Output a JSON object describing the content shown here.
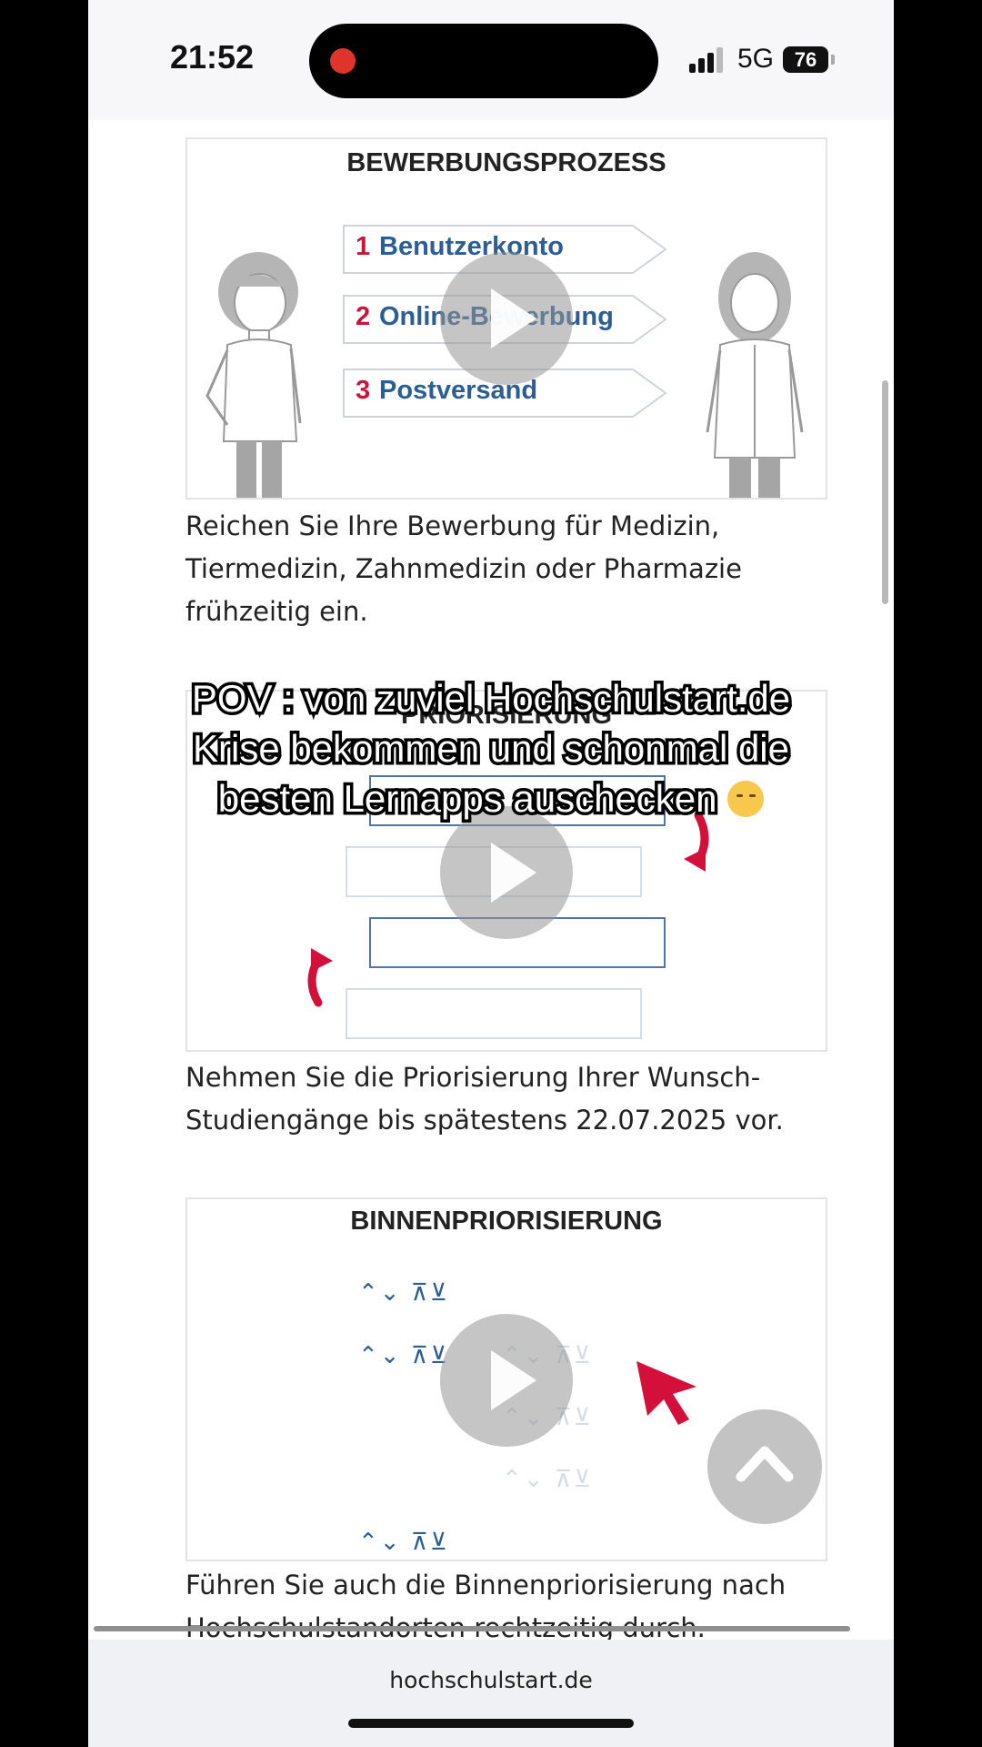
{
  "status": {
    "time": "21:52",
    "network": "5G",
    "battery": "76"
  },
  "figures": {
    "bewerbung": {
      "title": "BEWERBUNGSPROZESS",
      "steps": [
        {
          "num": "1",
          "label": "Benutzerkonto"
        },
        {
          "num": "2",
          "label": "Online-Bewerbung"
        },
        {
          "num": "3",
          "label": "Postversand"
        }
      ],
      "caption": "Reichen Sie Ihre Bewerbung für Medizin, Tiermedizin, Zahnmedizin oder Pharmazie frühzeitig ein."
    },
    "prio": {
      "title": "PRIORISIERUNG",
      "caption": "Nehmen Sie die Priorisierung Ihrer Wunsch-Studiengänge bis spätestens 22.07.2025 vor."
    },
    "binnen": {
      "title": "BINNENPRIORISIERUNG",
      "arrows": "⌃⌄ ⊼⊻",
      "caption": "Führen Sie auch die Binnenpriorisierung nach Hochschulstandorten rechtzeitig durch."
    }
  },
  "overlay": {
    "line1": "POV : von zuviel Hochschulstart.de",
    "line2": "Krise bekommen und schonmal die",
    "line3": "besten Lernapps auschecken"
  },
  "browser": {
    "url": "hochschulstart.de"
  },
  "colors": {
    "accent_red": "#c8163a",
    "step_blue": "#2c5d94"
  }
}
